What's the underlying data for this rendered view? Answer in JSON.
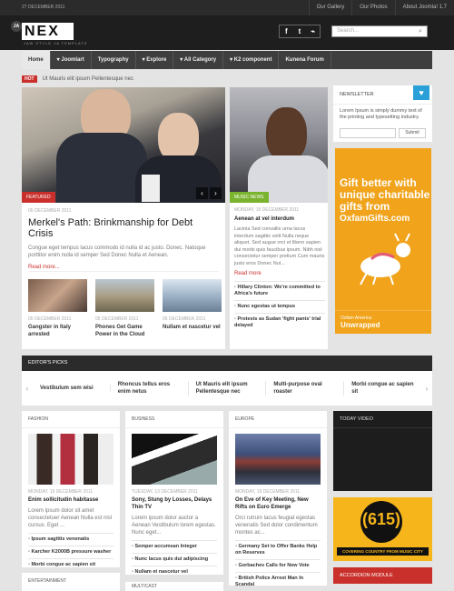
{
  "topbar": {
    "date": "27 December 2011",
    "links": [
      "Our Gallery",
      "Our Photos",
      "About Joomla! 1.7"
    ]
  },
  "header": {
    "logo_text": "NEX",
    "logo_badge": "JA",
    "tagline": "JAW STYLE JA TEMPLATE",
    "search_placeholder": "Search..."
  },
  "nav": {
    "items": [
      "Home",
      "Joomlart",
      "Typography",
      "Explore",
      "All Category",
      "K2 component",
      "Kunena Forum"
    ]
  },
  "ticker": {
    "badge": "HOT",
    "text": "Ut Mauris elit ipsum Pellentesque nec"
  },
  "featured": {
    "tag": "FEATURED",
    "date": "05 DECEMBER 2011",
    "title": "Merkel's Path: Brinkmanship for Debt Crisis",
    "body": "Congue eget tempus lacus commodo id nulla id ac justo. Donec. Natoque porttitor enim nulla id semper Sed Donec Nulla et Aenean.",
    "read_more": "Read more..."
  },
  "thumbs": [
    {
      "date": "05 DECEMBER 2011",
      "title": "Gangster in Italy arrested"
    },
    {
      "date": "05 DECEMBER 2011",
      "title": "Phones Get Game Power in the Cloud"
    },
    {
      "date": "05 DECEMBER 2011",
      "title": "Nullam et nascetur vel"
    }
  ],
  "music": {
    "tag": "MUSIC NEWS",
    "date": "MONDAY, 19 DECEMBER 2011",
    "title": "Aenean at vel interdum",
    "body": "Lacinia Sed convallis urna lacus interdum sagittis velit Nulla neque aliquet. Sed augue orci et libero sapien dui morbi quis faucibus ipsum. Nibh nisl consectetur semper pretium Cum mauris justo eros Donec Nul...",
    "read_more": "Read more",
    "links": [
      "Hillary Clinton: We're committed to Africa's future",
      "Nunc egestas ut tempus",
      "Protests as Sudan 'fight pants' trial delayed"
    ]
  },
  "newsletter": {
    "title": "NEWSLETTER",
    "body": "Lorem Ipsum is simply dummy text of the printing and typesetting industry.",
    "submit": "Submit"
  },
  "ad": {
    "lines": [
      "Gift better with",
      "unique charitable",
      "gifts from",
      "OxfamGifts.com"
    ],
    "footer": "Oxfam America",
    "footer2": "Unwrapped"
  },
  "editors": {
    "title": "EDITOR'S PICKS",
    "items": [
      "Vestibulum sem wisi",
      "Rhoncus tellus eros enim netus",
      "Ut Mauris elit ipsum Pellentesque nec",
      "Multi-purpose oval roaster",
      "Morbi congue ac sapien sit"
    ]
  },
  "fashion": {
    "title": "FASHION",
    "date": "MONDAY, 19 DECEMBER 2011",
    "headline": "Enim sollicitudin habitasse",
    "body": "Lorem ipsum dolor sit amet consectetuer Aenean Nulla est nisl cursus. Eget ...",
    "links": [
      "Ipsum sagittis venenatis",
      "Karcher K2000B pressure washer",
      "Morbi congue ac sapien sit"
    ]
  },
  "business": {
    "title": "BUSINESS",
    "date": "TUESDAY, 13 DECEMBER 2011",
    "headline": "Sony, Stung by Losses, Delays Thin TV",
    "body": "Lorem ipsum dolor auctor a Aenean Vestibulum lorem egestas. Nunc eget...",
    "links": [
      "Semper accumsan Integer",
      "Nunc lacus quis dui adipiscing",
      "Nullam et nascetur vel"
    ]
  },
  "europe": {
    "title": "EUROPE",
    "date": "MONDAY, 19 DECEMBER 2011",
    "headline": "On Eve of Key Meeting, New Rifts on Euro Emerge",
    "body": "Orci rutrum lacus feugiat egestas venenatis Sed dolor condimentum montes ac...",
    "links": [
      "Germany Set to Offer Banks Help on Reserves",
      "Gorbachev Calls for New Vote",
      "British Police Arrest Man In Scandal"
    ]
  },
  "today_video": {
    "title": "TODAY VIDEO"
  },
  "country_ad": {
    "number": "615",
    "slogan": "COVERING COUNTRY FROM MUSIC CITY"
  },
  "accordion": {
    "title": "ACCORDION MODULE"
  },
  "entertainment": {
    "title": "ENTERTAINMENT"
  },
  "multicast": {
    "title": "MULTICAST"
  }
}
